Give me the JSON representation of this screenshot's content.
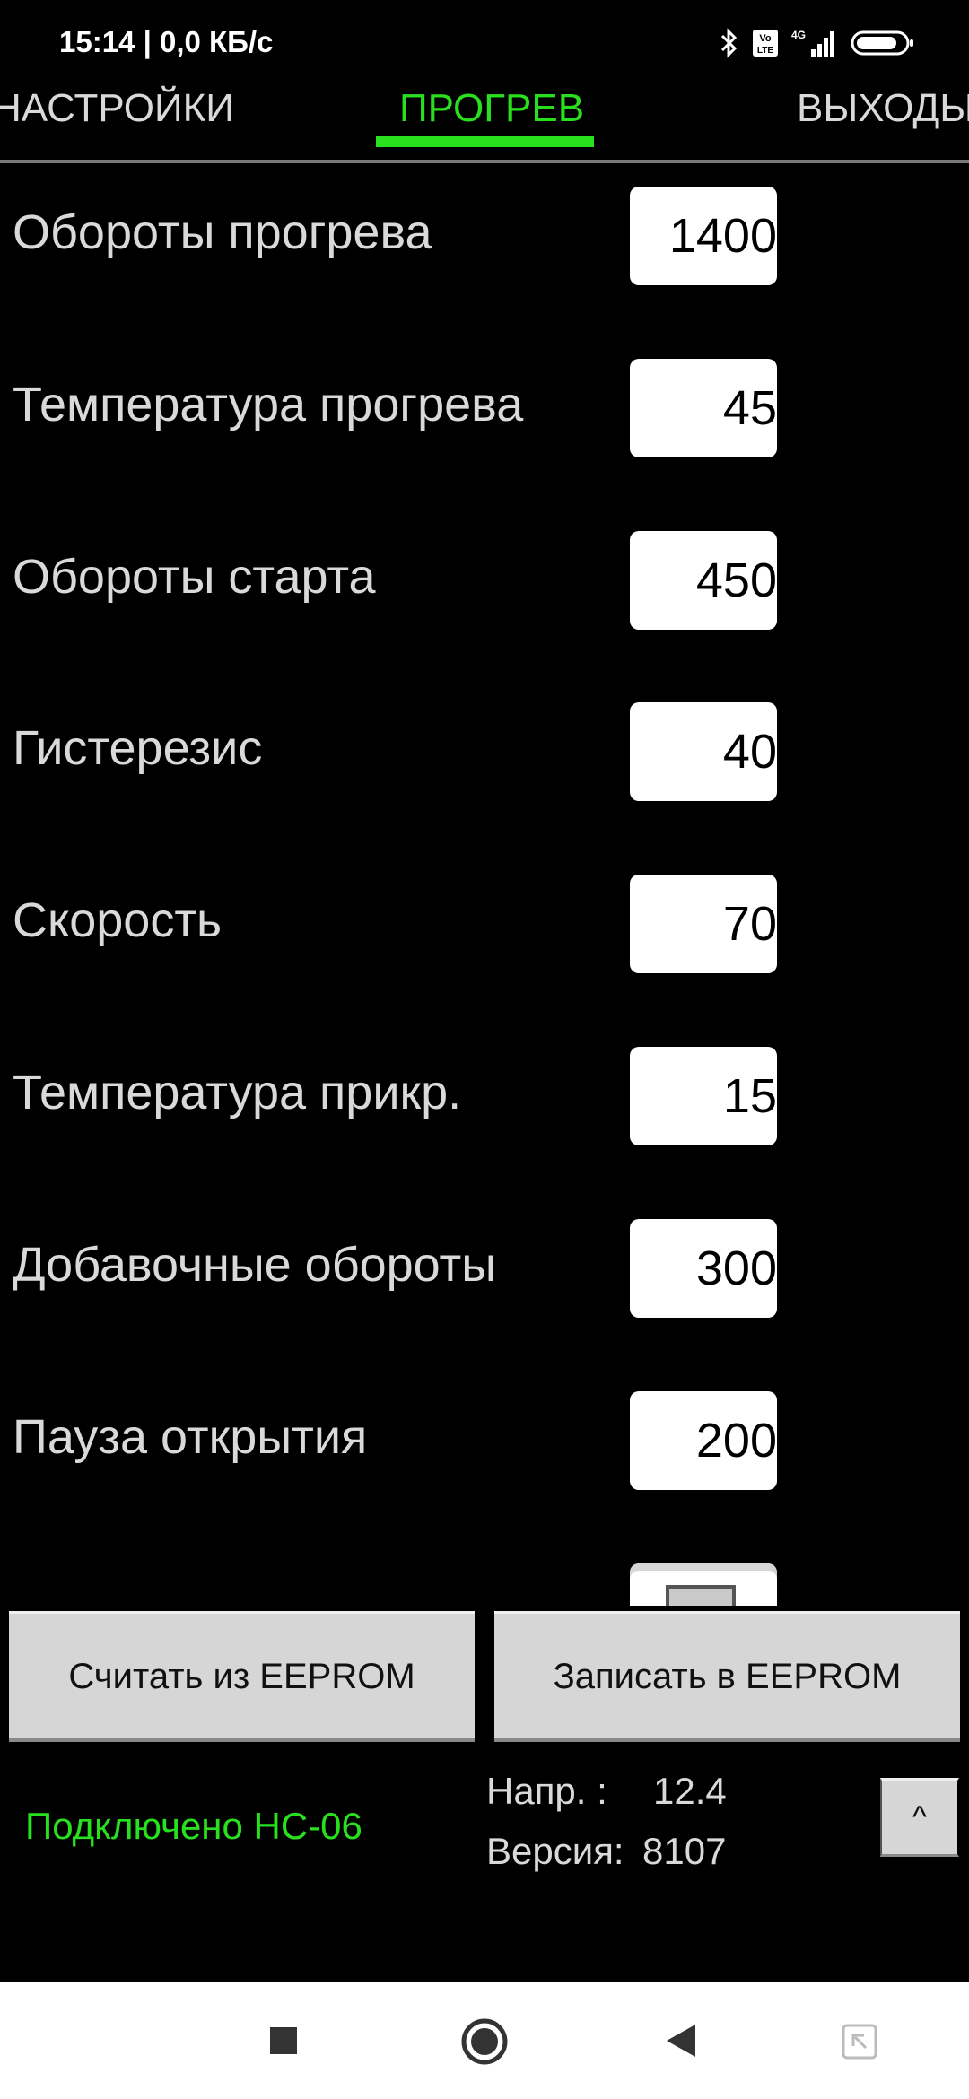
{
  "status_bar": {
    "text": "15:14 | 0,0 КБ/с",
    "icons": [
      "bluetooth-icon",
      "volte-icon",
      "signal-4g-icon",
      "battery-icon"
    ]
  },
  "tabs": [
    {
      "label": "НАСТРОЙКИ",
      "active": false
    },
    {
      "label": "ПРОГРЕВ",
      "active": true
    },
    {
      "label": "ВЫХОДЫ",
      "active": false
    }
  ],
  "params": [
    {
      "label": "Обороты прогрева",
      "value": "1400"
    },
    {
      "label": "Температура прогрева",
      "value": "45"
    },
    {
      "label": "Обороты старта",
      "value": "450"
    },
    {
      "label": "Гистерезис",
      "value": "40"
    },
    {
      "label": "Скорость",
      "value": "70"
    },
    {
      "label": "Температура прикр.",
      "value": "15"
    },
    {
      "label": "Добавочные обороты",
      "value": "300"
    },
    {
      "label": "Пауза открытия",
      "value": "200"
    }
  ],
  "buttons": {
    "read": "Считать из EEPROM",
    "write": "Записать в EEPROM",
    "up": "^"
  },
  "footer": {
    "connection": "Подключено HC-06",
    "voltage_label": "Напр. :",
    "voltage_value": "12.4",
    "version_label": "Версия:",
    "version_value": "8107"
  },
  "colors": {
    "accent": "#28e01e",
    "background": "#000000",
    "text": "#d9d9d9"
  },
  "nav_bar": {
    "icons": [
      "recents-square-icon",
      "home-circle-icon",
      "back-triangle-icon",
      "screenshot-expand-icon"
    ]
  }
}
